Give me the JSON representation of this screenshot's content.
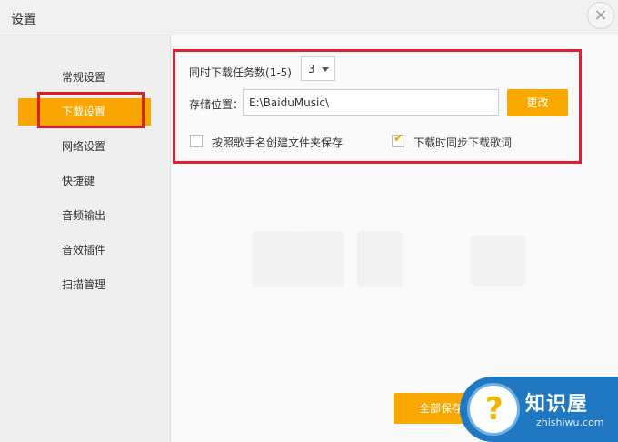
{
  "window": {
    "title": "设置",
    "close_glyph": "×"
  },
  "sidebar": {
    "items": [
      {
        "label": "常规设置",
        "active": false
      },
      {
        "label": "下载设置",
        "active": true
      },
      {
        "label": "网络设置",
        "active": false
      },
      {
        "label": "快捷键",
        "active": false
      },
      {
        "label": "音频输出",
        "active": false
      },
      {
        "label": "音效插件",
        "active": false
      },
      {
        "label": "扫描管理",
        "active": false
      }
    ]
  },
  "download": {
    "concurrent_label": "同时下载任务数(1-5)",
    "concurrent_value": "3",
    "location_label": "存储位置：",
    "location_value": "E:\\BaiduMusic\\",
    "change_button": "更改",
    "option_artist_folder": {
      "label": "按照歌手名创建文件夹保存",
      "checked": false
    },
    "option_sync_lyrics": {
      "label": "下载时同步下载歌词",
      "checked": true,
      "tick": "✔"
    }
  },
  "footer": {
    "save_all_label": "全部保存"
  },
  "watermark": {
    "glyph": "?",
    "title": "知识屋",
    "site": "zhishiwu.com"
  },
  "colors": {
    "accent": "#f9a800",
    "highlight_border": "#e02030",
    "watermark_bg": "#1f78c0"
  }
}
